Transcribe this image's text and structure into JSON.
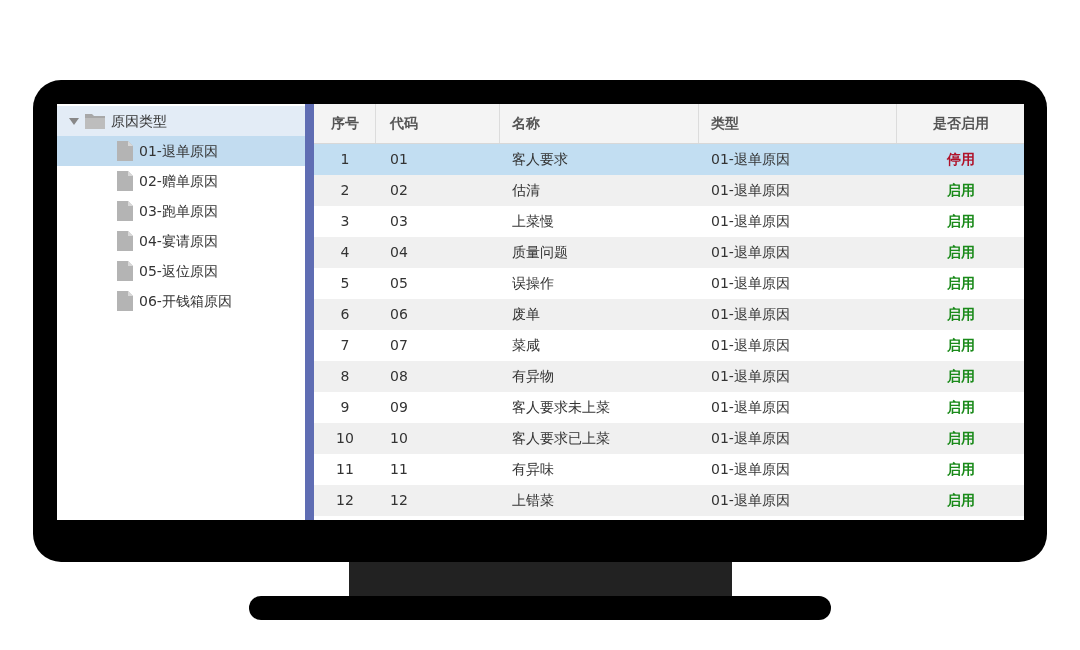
{
  "tree": {
    "label": "原因类型",
    "expanded": true,
    "children": [
      {
        "label": "01-退单原因",
        "selected": true
      },
      {
        "label": "02-赠单原因",
        "selected": false
      },
      {
        "label": "03-跑单原因",
        "selected": false
      },
      {
        "label": "04-宴请原因",
        "selected": false
      },
      {
        "label": "05-返位原因",
        "selected": false
      },
      {
        "label": "06-开钱箱原因",
        "selected": false
      }
    ]
  },
  "table": {
    "columns": [
      "序号",
      "代码",
      "名称",
      "类型",
      "是否启用"
    ],
    "rows": [
      {
        "index": "1",
        "code": "01",
        "name": "客人要求",
        "type": "01-退单原因",
        "status": "停用",
        "enabled": false,
        "selected": true
      },
      {
        "index": "2",
        "code": "02",
        "name": "估清",
        "type": "01-退单原因",
        "status": "启用",
        "enabled": true,
        "selected": false
      },
      {
        "index": "3",
        "code": "03",
        "name": "上菜慢",
        "type": "01-退单原因",
        "status": "启用",
        "enabled": true,
        "selected": false
      },
      {
        "index": "4",
        "code": "04",
        "name": "质量问题",
        "type": "01-退单原因",
        "status": "启用",
        "enabled": true,
        "selected": false
      },
      {
        "index": "5",
        "code": "05",
        "name": "误操作",
        "type": "01-退单原因",
        "status": "启用",
        "enabled": true,
        "selected": false
      },
      {
        "index": "6",
        "code": "06",
        "name": "废单",
        "type": "01-退单原因",
        "status": "启用",
        "enabled": true,
        "selected": false
      },
      {
        "index": "7",
        "code": "07",
        "name": "菜咸",
        "type": "01-退单原因",
        "status": "启用",
        "enabled": true,
        "selected": false
      },
      {
        "index": "8",
        "code": "08",
        "name": "有异物",
        "type": "01-退单原因",
        "status": "启用",
        "enabled": true,
        "selected": false
      },
      {
        "index": "9",
        "code": "09",
        "name": "客人要求未上菜",
        "type": "01-退单原因",
        "status": "启用",
        "enabled": true,
        "selected": false
      },
      {
        "index": "10",
        "code": "10",
        "name": "客人要求已上菜",
        "type": "01-退单原因",
        "status": "启用",
        "enabled": true,
        "selected": false
      },
      {
        "index": "11",
        "code": "11",
        "name": "有异味",
        "type": "01-退单原因",
        "status": "启用",
        "enabled": true,
        "selected": false
      },
      {
        "index": "12",
        "code": "12",
        "name": "上错菜",
        "type": "01-退单原因",
        "status": "启用",
        "enabled": true,
        "selected": false
      }
    ]
  }
}
